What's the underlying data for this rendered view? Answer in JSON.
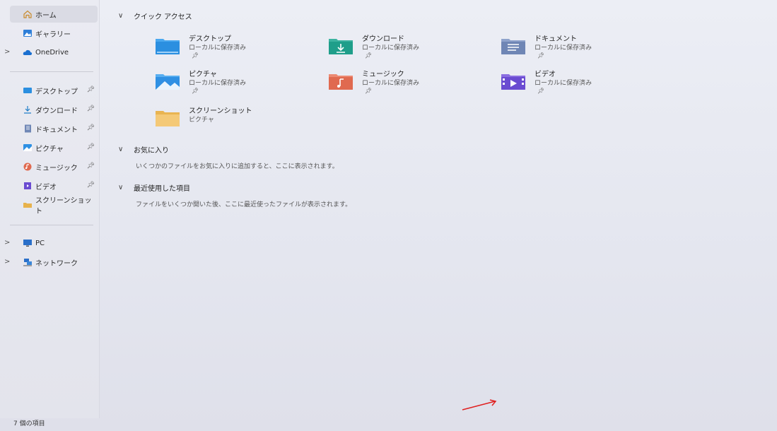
{
  "sidebar": {
    "items": [
      {
        "label": "ホーム",
        "icon": "home-icon"
      },
      {
        "label": "ギャラリー",
        "icon": "gallery-icon"
      },
      {
        "label": "OneDrive",
        "icon": "cloud-icon"
      },
      {
        "label": "デスクトップ",
        "icon": "desktop-folder-icon"
      },
      {
        "label": "ダウンロード",
        "icon": "download-icon"
      },
      {
        "label": "ドキュメント",
        "icon": "document-icon"
      },
      {
        "label": "ピクチャ",
        "icon": "pictures-icon"
      },
      {
        "label": "ミュージック",
        "icon": "music-icon"
      },
      {
        "label": "ビデオ",
        "icon": "video-icon"
      },
      {
        "label": "スクリーンショット",
        "icon": "folder-icon"
      },
      {
        "label": "PC",
        "icon": "pc-icon"
      },
      {
        "label": "ネットワーク",
        "icon": "network-icon"
      }
    ]
  },
  "main": {
    "quick_access": {
      "title": "クイック アクセス",
      "items": [
        {
          "name": "デスクトップ",
          "sub": "ローカルに保存済み",
          "color": "#2b8fe0"
        },
        {
          "name": "ダウンロード",
          "sub": "ローカルに保存済み",
          "color": "#1f9e8a"
        },
        {
          "name": "ドキュメント",
          "sub": "ローカルに保存済み",
          "color": "#6f86b5"
        },
        {
          "name": "ピクチャ",
          "sub": "ローカルに保存済み",
          "color": "#2f90e3"
        },
        {
          "name": "ミュージック",
          "sub": "ローカルに保存済み",
          "color": "#e06a50"
        },
        {
          "name": "ビデオ",
          "sub": "ローカルに保存済み",
          "color": "#6a4bd1"
        },
        {
          "name": "スクリーンショット",
          "sub": "ピクチャ",
          "color": "#f0c060"
        }
      ]
    },
    "favorites": {
      "title": "お気に入り",
      "hint": "いくつかのファイルをお気に入りに追加すると、ここに表示されます。"
    },
    "recent": {
      "title": "最近使用した項目",
      "hint": "ファイルをいくつか開いた後、ここに最近使ったファイルが表示されます。"
    }
  },
  "status": {
    "text": "7 個の項目"
  },
  "colors": {
    "accent": "#0067c0",
    "arrow": "#e02020"
  }
}
